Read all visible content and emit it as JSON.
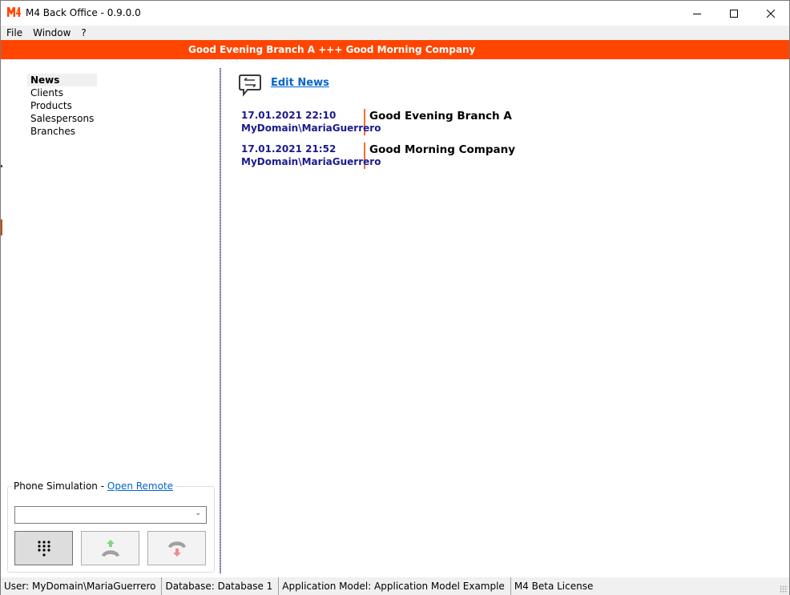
{
  "window": {
    "title": "M4 Back Office - 0.9.0.0",
    "logo": "M4",
    "controls": [
      "minimize-icon",
      "maximize-icon",
      "close-icon"
    ]
  },
  "menu": {
    "items": [
      {
        "label": "File"
      },
      {
        "label": "Window"
      },
      {
        "label": "?"
      }
    ]
  },
  "banner": {
    "text": "Good Evening Branch A +++ Good Morning Company",
    "color": "#ff4500"
  },
  "sidebar": {
    "items": [
      {
        "label": "News",
        "active": true
      },
      {
        "label": "Clients"
      },
      {
        "label": "Products"
      },
      {
        "label": "Salespersons"
      },
      {
        "label": "Branches"
      }
    ]
  },
  "phone": {
    "label": "Phone Simulation - ",
    "link": "Open Remote",
    "select_value": "",
    "buttons": [
      {
        "name": "dialpad",
        "icon": "dialpad-icon"
      },
      {
        "name": "accept-call",
        "icon": "phone-accept-icon"
      },
      {
        "name": "hang-up",
        "icon": "phone-hangup-icon"
      }
    ]
  },
  "main": {
    "edit_link": "Edit News",
    "edit_icon": "chat-swap-icon",
    "news": [
      {
        "timestamp": "17.01.2021 22:10",
        "author": "MyDomain\\MariaGuerrero",
        "text": "Good Evening Branch A"
      },
      {
        "timestamp": "17.01.2021 21:52",
        "author": "MyDomain\\MariaGuerrero",
        "text": "Good Morning Company"
      }
    ]
  },
  "status": {
    "user": "User: MyDomain\\MariaGuerrero",
    "database": "Database: Database 1",
    "model": "Application Model: Application Model Example",
    "license": "M4 Beta License"
  },
  "colors": {
    "accent": "#ff4500",
    "link": "#0066cc",
    "news_meta": "#1a1a8c"
  }
}
